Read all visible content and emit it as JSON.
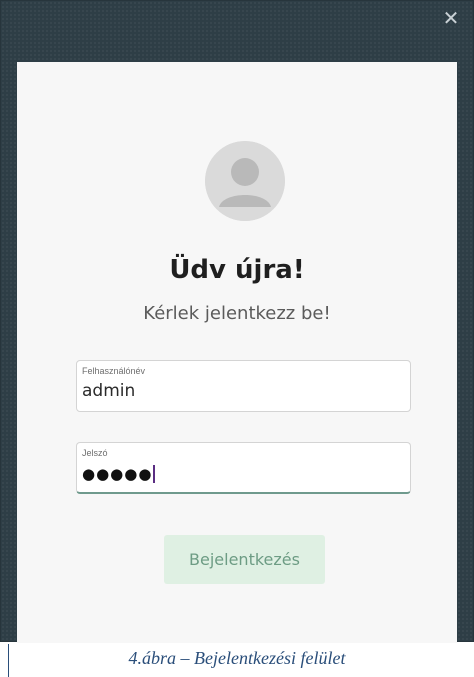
{
  "window": {
    "close_glyph": "✕"
  },
  "login": {
    "avatar_icon": "user-avatar-icon",
    "welcome": "Üdv újra!",
    "subtitle": "Kérlek jelentkezz be!",
    "username": {
      "label": "Felhasználónév",
      "value": "admin"
    },
    "password": {
      "label": "Jelszó",
      "masked_value": "●●●●●"
    },
    "submit_label": "Bejelentkezés"
  },
  "caption": "4.ábra – Bejelentkezési felület",
  "colors": {
    "window_bg": "#2e3e46",
    "panel_bg": "#f7f7f7",
    "button_bg": "#dff0e3",
    "button_text": "#6d9c84",
    "focus_underline": "#6f9a8d",
    "caption_text": "#2a4e7a"
  }
}
